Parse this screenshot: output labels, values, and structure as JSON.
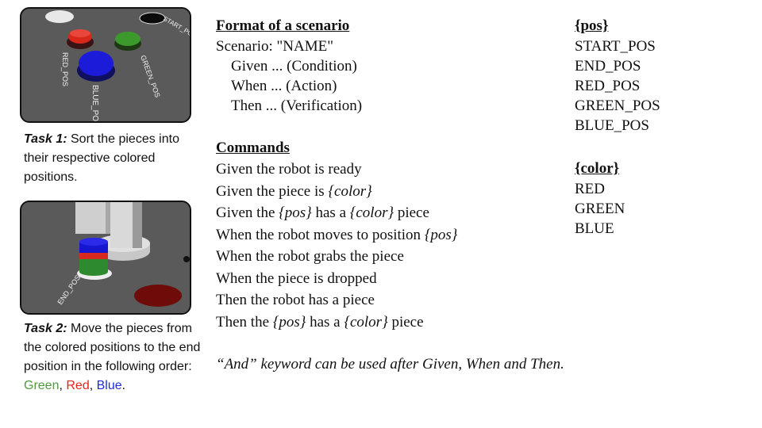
{
  "images": {
    "task1": {
      "labels": [
        "RED_POS",
        "GREEN_POS",
        "BLUE_POS",
        "START_POS"
      ],
      "colors": {
        "red": "#d8281c",
        "green": "#3c9a2c",
        "blue": "#1b1bd8",
        "floor": "#5a5a5a"
      }
    },
    "task2": {
      "labels": [
        "END_POS"
      ],
      "stack": [
        "BLUE",
        "RED",
        "GREEN"
      ],
      "colors": {
        "red": "#6d0c08",
        "green": "#2e8a2e",
        "blue": "#1616d0",
        "floor": "#5a5a5a"
      }
    }
  },
  "task1": {
    "label": "Task 1:",
    "text": " Sort the pieces into their respective colored positions."
  },
  "task2": {
    "label": "Task 2:",
    "text": " Move the pieces from the colored positions to the end position in the following order: ",
    "order": [
      {
        "text": "Green",
        "color": "#4f9a3e"
      },
      {
        "text": "Red",
        "color": "#e3261c"
      },
      {
        "text": "Blue",
        "color": "#1f2fd6"
      }
    ],
    "sep": ", ",
    "end": "."
  },
  "format": {
    "heading": "Format of a scenario",
    "scenario": "Scenario: \"NAME\"",
    "given": "Given ...  (Condition)",
    "when": "When ... (Action)",
    "then": "Then ... (Verification)"
  },
  "commands": {
    "heading": "Commands",
    "c1": "Given the robot is ready",
    "c2_pre": "Given the piece is ",
    "c2_var": "{color}",
    "c3_pre": "Given the ",
    "c3_var1": "{pos}",
    "c3_mid": " has a ",
    "c3_var2": "{color}",
    "c3_post": " piece",
    "c4_pre": "When the robot moves to position ",
    "c4_var": "{pos}",
    "c5": "When the robot grabs the piece",
    "c6": "When the piece is dropped",
    "c7": "Then the robot has a piece",
    "c8_pre": "Then the ",
    "c8_var1": "{pos}",
    "c8_mid": " has a ",
    "c8_var2": "{color}",
    "c8_post": " piece"
  },
  "pos": {
    "heading": "{pos}",
    "items": [
      "START_POS",
      "END_POS",
      "RED_POS",
      "GREEN_POS",
      "BLUE_POS"
    ]
  },
  "color": {
    "heading": "{color}",
    "items": [
      "RED",
      "GREEN",
      "BLUE"
    ]
  },
  "note": "“And” keyword can be used after Given, When and Then."
}
